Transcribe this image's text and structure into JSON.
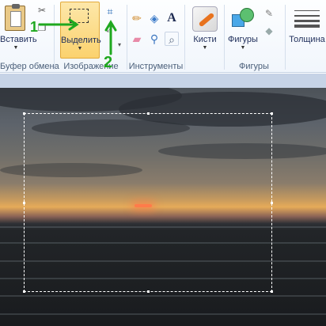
{
  "ribbon": {
    "clipboard": {
      "paste_label": "Вставить",
      "group_label": "Буфер обмена"
    },
    "image": {
      "select_label": "Выделить",
      "group_label": "Изображение"
    },
    "tools": {
      "group_label": "Инструменты",
      "text_glyph": "A"
    },
    "brushes": {
      "label": "Кисти"
    },
    "shapes": {
      "label": "Фигуры",
      "group_label": "Фигуры"
    },
    "size": {
      "label": "Толщина"
    }
  },
  "annotations": {
    "marker_1": "1",
    "marker_2": "2"
  },
  "colors": {
    "select_bg": "#fbd26e",
    "annotation": "#1fa81f",
    "selection_border": "#ffffff"
  },
  "icons": [
    "paste-icon",
    "select-icon",
    "crop-icon",
    "pencil-icon",
    "fill-icon",
    "text-icon",
    "eraser-icon",
    "color-picker-icon",
    "magnifier-icon",
    "brushes-icon",
    "shapes-icon",
    "outline-icon",
    "fill-shape-icon",
    "line-thickness-icon"
  ]
}
